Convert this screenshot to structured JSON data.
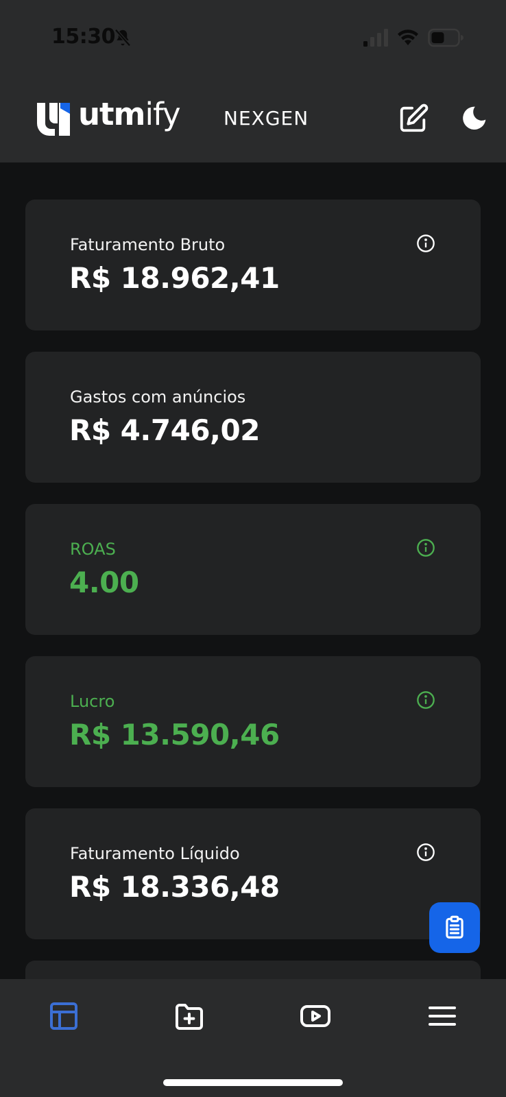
{
  "status_bar": {
    "time": "15:30",
    "icons": [
      "bell-off-icon",
      "signal-icon",
      "wifi-icon",
      "battery-icon"
    ]
  },
  "header": {
    "logo_bold": "utm",
    "logo_light": "ify",
    "workspace_name": "NEXGEN",
    "edit_icon": "edit-icon",
    "theme_icon": "moon-icon"
  },
  "cards": [
    {
      "label": "Faturamento Bruto",
      "value": "R$ 18.962,41",
      "has_info": true
    },
    {
      "label": "Gastos com anúncios",
      "value": "R$ 4.746,02",
      "has_info": false
    },
    {
      "label": "ROAS",
      "value": "4.00",
      "has_info": true
    },
    {
      "label": "Lucro",
      "value": "R$ 13.590,46",
      "has_info": true
    },
    {
      "label": "Faturamento Líquido",
      "value": "R$ 18.336,48",
      "has_info": true
    }
  ],
  "fab": {
    "icon": "clipboard-icon"
  },
  "bottom_nav": {
    "items": [
      "dashboard-icon",
      "folder-plus-icon",
      "video-icon",
      "menu-icon"
    ],
    "active_index": 0
  },
  "colors": {
    "accent_green": "#4caf50",
    "accent_blue": "#1565e8",
    "card_bg": "#222324",
    "page_bg": "#111213",
    "bar_bg": "#2a2b2c",
    "nav_active": "#3b6fd4"
  }
}
